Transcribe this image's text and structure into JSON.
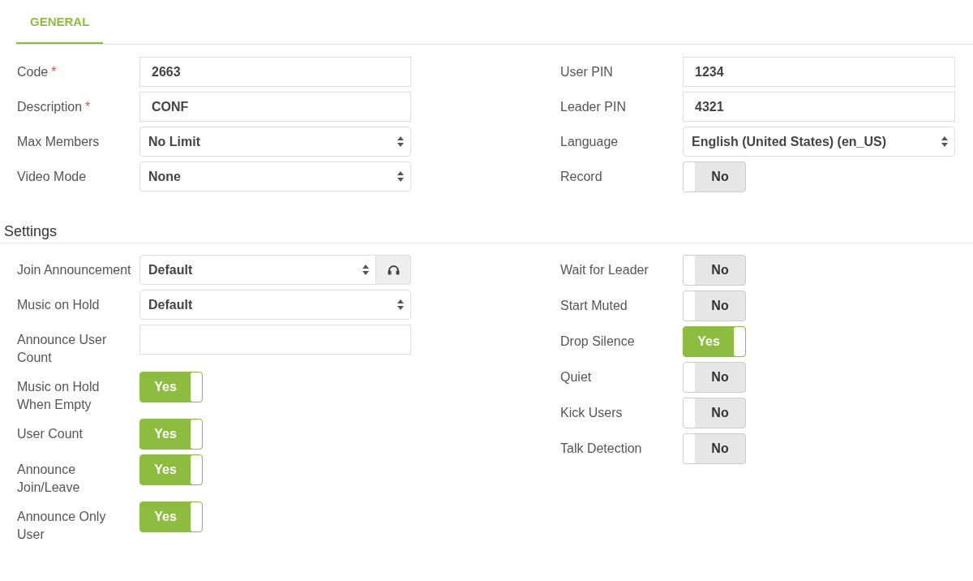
{
  "tabs": [
    {
      "label": "GENERAL",
      "selected": true
    }
  ],
  "general": {
    "left": [
      {
        "kind": "text",
        "label": "Code",
        "required_mark": "*",
        "value": "2663"
      },
      {
        "kind": "text",
        "label": "Description",
        "required_mark": "*",
        "value": "CONF"
      },
      {
        "kind": "select",
        "label": "Max Members",
        "value": "No Limit"
      },
      {
        "kind": "select",
        "label": "Video Mode",
        "value": "None"
      }
    ],
    "right": [
      {
        "kind": "text",
        "label": "User PIN",
        "value": "1234"
      },
      {
        "kind": "text",
        "label": "Leader PIN",
        "value": "4321"
      },
      {
        "kind": "select",
        "label": "Language",
        "value": "English (United States) (en_US)"
      },
      {
        "kind": "toggle",
        "label": "Record",
        "on": false,
        "text": "No"
      }
    ]
  },
  "settings": {
    "title": "Settings",
    "left": [
      {
        "kind": "select-audio",
        "label": "Join Announcement",
        "value": "Default"
      },
      {
        "kind": "select",
        "label": "Music on Hold",
        "value": "Default"
      },
      {
        "kind": "text",
        "label": "Announce User Count"
      },
      {
        "kind": "toggle",
        "label": "Music on Hold When Empty",
        "on": true,
        "text": "Yes"
      },
      {
        "kind": "toggle",
        "label": "User Count",
        "on": true,
        "text": "Yes"
      },
      {
        "kind": "toggle",
        "label": "Announce Join/Leave",
        "on": true,
        "text": "Yes"
      },
      {
        "kind": "toggle",
        "label": "Announce Only User",
        "on": true,
        "text": "Yes"
      }
    ],
    "right": [
      {
        "kind": "toggle",
        "label": "Wait for Leader",
        "on": false,
        "text": "No"
      },
      {
        "kind": "toggle",
        "label": "Start Muted",
        "on": false,
        "text": "No"
      },
      {
        "kind": "toggle",
        "label": "Drop Silence",
        "on": true,
        "text": "Yes"
      },
      {
        "kind": "toggle",
        "label": "Quiet",
        "on": false,
        "text": "No"
      },
      {
        "kind": "toggle",
        "label": "Kick Users",
        "on": false,
        "text": "No"
      },
      {
        "kind": "toggle",
        "label": "Talk Detection",
        "on": false,
        "text": "No"
      }
    ]
  }
}
